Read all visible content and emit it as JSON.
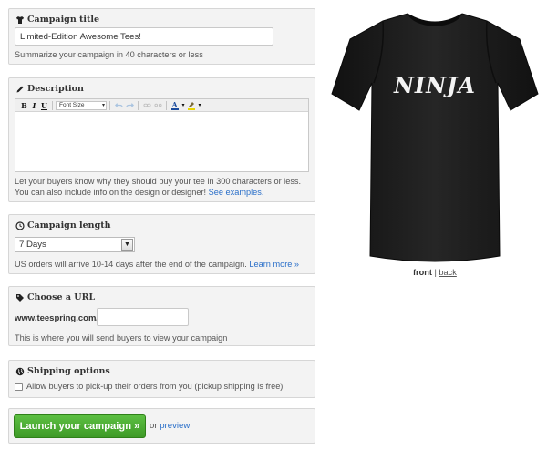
{
  "campaign_title": {
    "label": "Campaign title",
    "value": "Limited-Edition Awesome Tees!",
    "help": "Summarize your campaign in 40 characters or less"
  },
  "description": {
    "label": "Description",
    "toolbar": {
      "bold": "B",
      "italic": "I",
      "underline": "U",
      "font_size": "Font Size"
    },
    "help_line1": "Let your buyers know why they should buy your tee in 300 characters or less.",
    "help_line2": "You can also include info on the design or designer! ",
    "help_link": "See examples."
  },
  "campaign_length": {
    "label": "Campaign length",
    "selected": "7 Days",
    "help": "US orders will arrive 10-14 days after the end of the campaign. ",
    "help_link": "Learn more »"
  },
  "url": {
    "label": "Choose a URL",
    "prefix": "www.teespring.com/",
    "value": "",
    "help": "This is where you will send buyers to view your campaign"
  },
  "shipping": {
    "label": "Shipping options",
    "checkbox_label": "Allow buyers to pick-up their orders from you (pickup shipping is free)",
    "checked": false
  },
  "actions": {
    "launch": "Launch your campaign »",
    "or": "or ",
    "preview": "preview"
  },
  "preview": {
    "shirt_text": "NINJA",
    "shirt_color": "#1b1b1b",
    "front": "front",
    "separator": " | ",
    "back": "back"
  }
}
